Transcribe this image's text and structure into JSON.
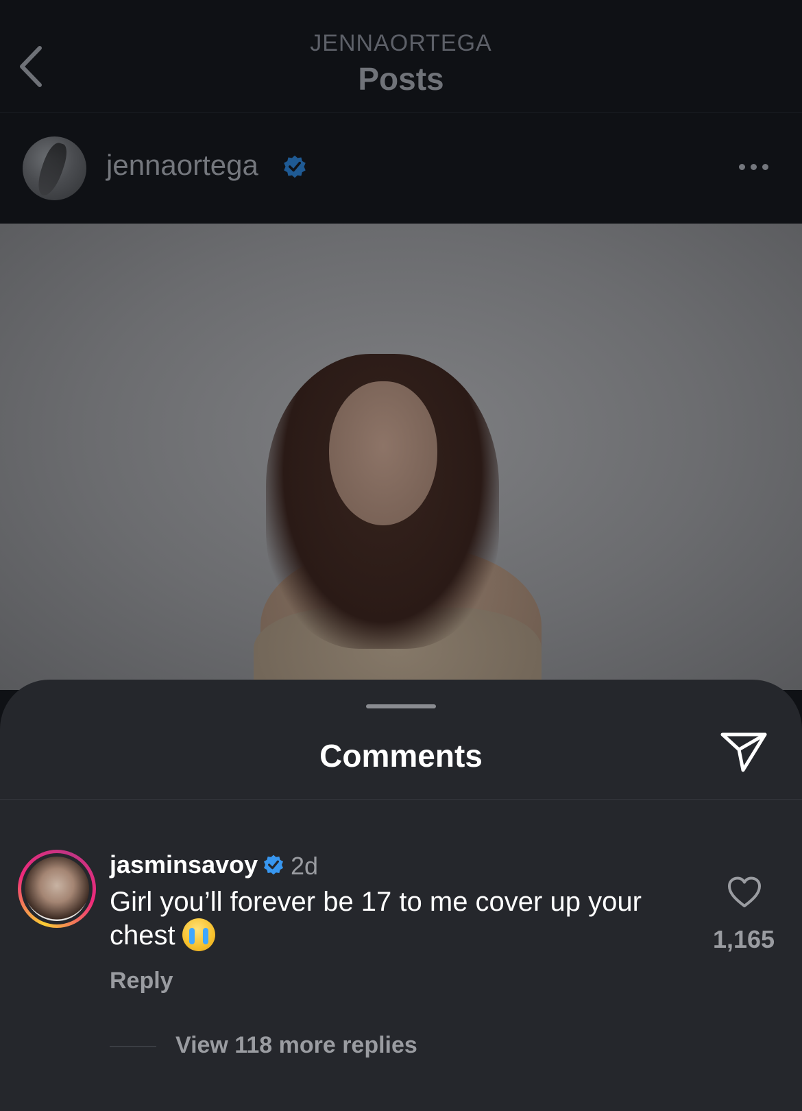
{
  "header": {
    "account": "JENNAORTEGA",
    "title": "Posts",
    "back_icon": "chevron-left-icon"
  },
  "post": {
    "username": "jennaortega",
    "verified": true,
    "more_icon": "more-horizontal-icon"
  },
  "comments_sheet": {
    "title": "Comments",
    "share_icon": "paper-plane-icon",
    "comment": {
      "username": "jasminsavoy",
      "verified": true,
      "time": "2d",
      "text": "Girl you’ll forever be 17 to me cover up your chest",
      "emoji": "loudly-crying-face",
      "reply_label": "Reply",
      "like_count": "1,165"
    },
    "view_replies_label": "View 118 more replies"
  },
  "colors": {
    "background": "#0f1115",
    "sheet": "#25272c",
    "verified_blue": "#3897f0",
    "muted_text": "#9a9ca1"
  }
}
